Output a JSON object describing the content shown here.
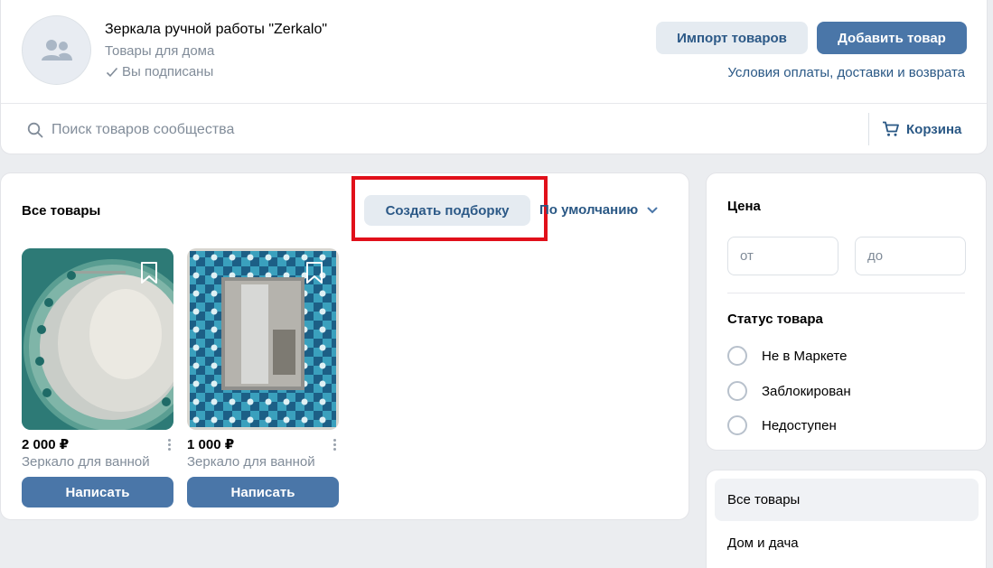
{
  "header": {
    "group_name": "Зеркала ручной работы \"Zerkalo\"",
    "group_category": "Товары для дома",
    "subscribed_label": "Вы подписаны",
    "import_button": "Импорт товаров",
    "add_button": "Добавить товар",
    "terms_link": "Условия оплаты, доставки и возврата"
  },
  "search": {
    "placeholder": "Поиск товаров сообщества",
    "value": ""
  },
  "cart_label": "Корзина",
  "products_section": {
    "title": "Все товары",
    "create_collection_button": "Создать подборку",
    "sort_label": "По умолчанию",
    "items": [
      {
        "price": "2 000 ₽",
        "title": "Зеркало для ванной",
        "button": "Написать"
      },
      {
        "price": "1 000 ₽",
        "title": "Зеркало для ванной",
        "button": "Написать"
      }
    ]
  },
  "filters": {
    "price_heading": "Цена",
    "price_from_placeholder": "от",
    "price_to_placeholder": "до",
    "status_heading": "Статус товара",
    "status_options": [
      "Не в Маркете",
      "Заблокирован",
      "Недоступен"
    ]
  },
  "categories": {
    "items": [
      "Все товары",
      "Дом и дача"
    ],
    "active_index": 0
  },
  "colors": {
    "accent": "#4a76a8",
    "link": "#2a5885",
    "secondary_button_bg": "#e5ebf1",
    "highlight": "#e1101a",
    "page_bg": "#ebedf0"
  },
  "icons": [
    "group-avatar-icon",
    "check-icon",
    "search-icon",
    "cart-icon",
    "chevron-down-icon",
    "bookmark-icon",
    "more-vertical-icon"
  ]
}
